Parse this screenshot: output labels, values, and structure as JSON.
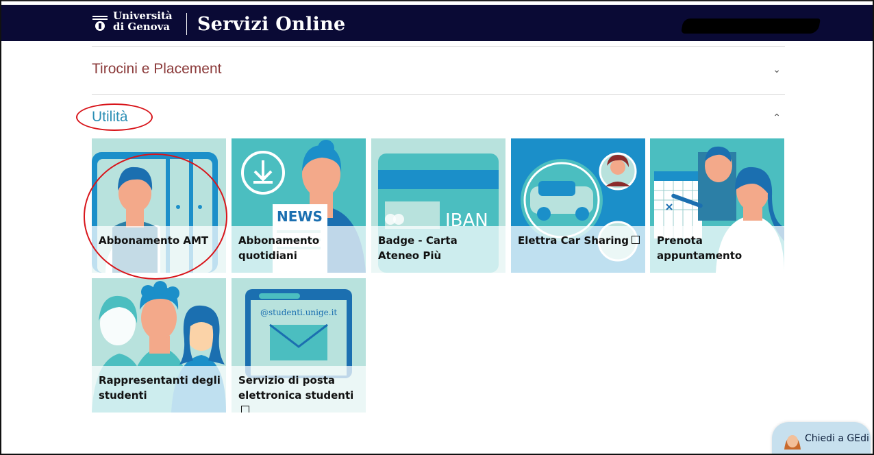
{
  "header": {
    "logo_line1": "Università",
    "logo_line2": "di Genova",
    "title": "Servizi Online"
  },
  "accordion": [
    {
      "title": "Tirocini e Placement",
      "chevron": "⌄",
      "expanded": false
    },
    {
      "title": "Utilità",
      "chevron": "⌃",
      "expanded": true
    }
  ],
  "tiles": [
    {
      "label": "Abbonamento AMT",
      "external": false,
      "icon": "bus-student-illustration"
    },
    {
      "label": "Abbonamento quotidiani",
      "external": false,
      "icon": "news-download-illustration"
    },
    {
      "label": "Badge - Carta Ateneo Più",
      "external": false,
      "icon": "iban-card-illustration"
    },
    {
      "label": "Elettra Car Sharing",
      "external": true,
      "icon": "car-sharing-illustration"
    },
    {
      "label": "Prenota appuntamento",
      "external": false,
      "icon": "calendar-appointment-illustration"
    },
    {
      "label": "Rappresentanti degli studenti",
      "external": false,
      "icon": "students-group-illustration"
    },
    {
      "label": "Servizio di posta elettronica studenti",
      "external": true,
      "icon": "email-illustration",
      "art_text": "@studenti.unige.it"
    }
  ],
  "illustration_text": {
    "news": "NEWS",
    "iban": "IBAN"
  },
  "chat": {
    "label": "Chiedi a GEdi"
  },
  "colors": {
    "header_bg": "#0a0a35",
    "teal": "#4bbec0",
    "light_teal": "#b8e2dd",
    "blue": "#1b8fc9",
    "annotation_red": "#d8151b"
  }
}
